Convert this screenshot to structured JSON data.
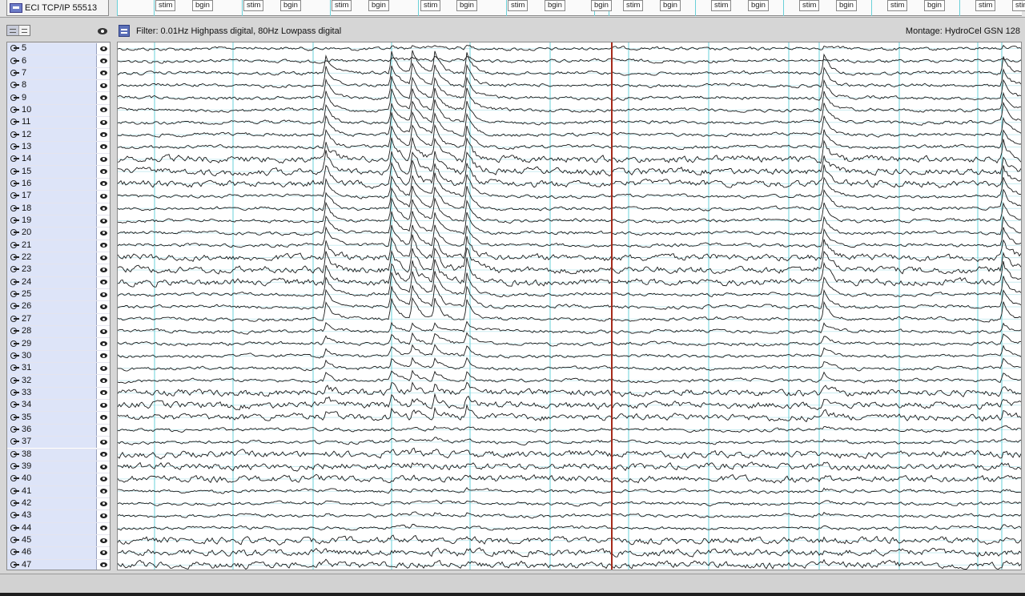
{
  "source": {
    "label": "ECI TCP/IP 55513",
    "icon": "network-source-icon"
  },
  "toolbar": {
    "filter_label": "Filter: 0.01Hz Highpass digital, 80Hz Lowpass digital",
    "montage_label": "Montage: HydroCel GSN 128"
  },
  "events": [
    {
      "label": "stim"
    },
    {
      "label": "bgin"
    },
    {
      "label": "stim"
    },
    {
      "label": "bgin"
    },
    {
      "label": "stim"
    },
    {
      "label": "bgin"
    },
    {
      "label": "stim"
    },
    {
      "label": "bgin"
    },
    {
      "label": "stim"
    },
    {
      "label": "bgin"
    },
    {
      "label": "bgin"
    },
    {
      "label": "stim"
    },
    {
      "label": "bgin"
    },
    {
      "label": "stim"
    },
    {
      "label": "bgin"
    },
    {
      "label": "stim"
    },
    {
      "label": "bgin"
    },
    {
      "label": "stim"
    },
    {
      "label": "bgin"
    },
    {
      "label": "stim"
    },
    {
      "label": "stim"
    }
  ],
  "channels": [
    "5",
    "6",
    "7",
    "8",
    "9",
    "10",
    "11",
    "12",
    "13",
    "14",
    "15",
    "16",
    "17",
    "18",
    "19",
    "20",
    "21",
    "22",
    "23",
    "24",
    "25",
    "26",
    "27",
    "28",
    "29",
    "30",
    "31",
    "32",
    "33",
    "34",
    "35",
    "36",
    "37",
    "38",
    "39",
    "40",
    "41",
    "42",
    "43",
    "44",
    "45",
    "46",
    "47"
  ],
  "colors": {
    "trace": "#1a1a1a",
    "grid_vertical": "#6ad0d8",
    "grid_horizontal": "#c9ecf0",
    "cursor": "#a52a1a",
    "channel_cell": "#dde4f8"
  }
}
